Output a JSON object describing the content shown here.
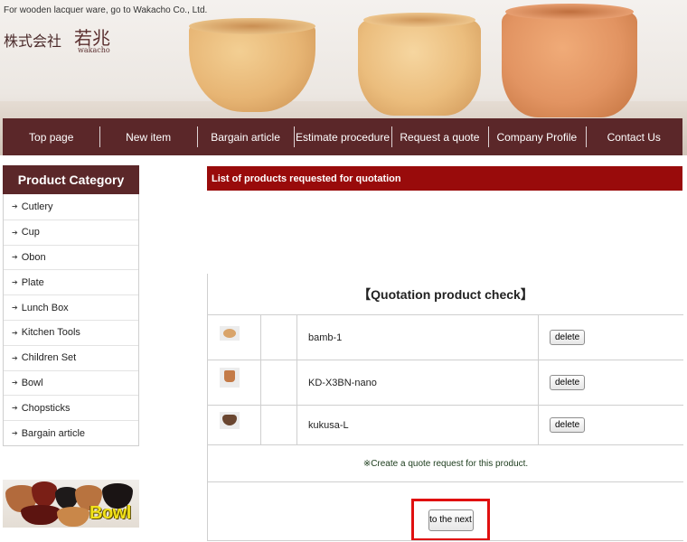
{
  "header": {
    "tagline": "For wooden lacquer ware, go to Wakacho Co., Ltd.",
    "logo_company": "株式会社",
    "logo_brand": "若兆",
    "logo_roman": "wakacho"
  },
  "nav": {
    "items": [
      {
        "label": "Top page"
      },
      {
        "label": "New item"
      },
      {
        "label": "Bargain article"
      },
      {
        "label": "Estimate procedure"
      },
      {
        "label": "Request a quote"
      },
      {
        "label": "Company Profile"
      },
      {
        "label": "Contact Us"
      }
    ]
  },
  "sidebar": {
    "title": "Product Category",
    "items": [
      {
        "label": "Cutlery"
      },
      {
        "label": "Cup"
      },
      {
        "label": "Obon"
      },
      {
        "label": "Plate"
      },
      {
        "label": "Lunch Box"
      },
      {
        "label": "Kitchen Tools"
      },
      {
        "label": "Children Set"
      },
      {
        "label": "Bowl"
      },
      {
        "label": "Chopsticks"
      },
      {
        "label": "Bargain article"
      }
    ],
    "banner_label": "Bowl"
  },
  "main": {
    "title": "List of products requested for quotation",
    "check_title": "【Quotation product check】",
    "products": [
      {
        "name": "bamb-1",
        "delete_label": "delete"
      },
      {
        "name": "KD-X3BN-nano",
        "delete_label": "delete"
      },
      {
        "name": "kukusa-L",
        "delete_label": "delete"
      }
    ],
    "note": "※Create a quote request for this product.",
    "next_label": "to the next"
  },
  "colors": {
    "nav_bg": "#5b2729",
    "title_bar": "#990b0b",
    "highlight": "#e01010"
  }
}
